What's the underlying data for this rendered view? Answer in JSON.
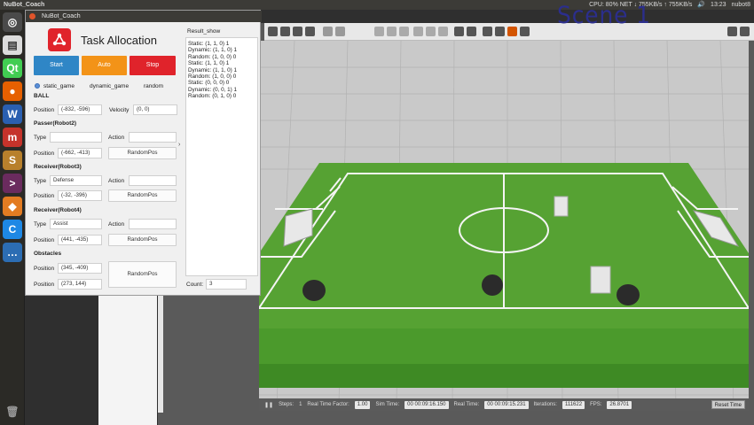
{
  "topbar": {
    "app_name": "NuBot_Coach",
    "tray_net": "CPU: 80% NET ↓ 755KB/s ↑ 755KB/s",
    "tray_time": "13:23",
    "tray_user": "nubot8"
  },
  "overlay_label": "Scene 1",
  "window": {
    "title": "NuBot_Coach",
    "app_title": "Task Allocation",
    "buttons": {
      "start": "Start",
      "auto": "Auto",
      "stop": "Stop"
    },
    "modes": [
      "static_game",
      "dynamic_game",
      "random"
    ],
    "selected_mode": "static_game",
    "ball": {
      "heading": "BALL",
      "position_label": "Position",
      "position_value": "(-832, -596)",
      "velocity_label": "Velocity",
      "velocity_value": "(0, 0)"
    },
    "passer": {
      "heading": "Passer(Robot2)",
      "type_label": "Type",
      "type_value": "",
      "action_label": "Action",
      "action_value": "",
      "position_label": "Position",
      "position_value": "(-662, -413)",
      "random_button": "RandomPos"
    },
    "receiver3": {
      "heading": "Receiver(Robot3)",
      "type_label": "Type",
      "type_value": "Defense",
      "action_label": "Action",
      "action_value": "",
      "position_label": "Position",
      "position_value": "(-32, -396)",
      "random_button": "RandomPos"
    },
    "receiver4": {
      "heading": "Receiver(Robot4)",
      "type_label": "Type",
      "type_value": "Assist",
      "action_label": "Action",
      "action_value": "",
      "position_label": "Position",
      "position_value": "(441, -435)",
      "random_button": "RandomPos"
    },
    "obstacles": {
      "heading": "Obstacles",
      "position_label": "Position",
      "positions": [
        "(345, -409)",
        "(273, 144)"
      ],
      "random_button": "RandomPos"
    },
    "result_title": "Result_show",
    "results": [
      "Static:  (1, 1, 0)  1",
      "Dynamic: (1, 1, 0)  1",
      "Random:  (1, 0, 0)  0",
      "Static:  (1, 1, 0)  1",
      "Dynamic: (1, 1, 0)  1",
      "Random:  (1, 0, 0)  0",
      "Static:  (0, 0, 0)  0",
      "Dynamic: (0, 0, 1)  1",
      "Random:  (0, 1, 0)  0"
    ],
    "count_label": "Count:",
    "count_value": "3"
  },
  "gazebo_bottom": {
    "steps_label": "Steps:",
    "steps_value": "1",
    "rtf_label": "Real Time Factor:",
    "rtf_value": "1.00",
    "sim_label": "Sim Time:",
    "sim_value": "00 00:09:16.150",
    "real_label": "Real Time:",
    "real_value": "00 00:09:15.231",
    "iter_label": "Iterations:",
    "iter_value": "111622",
    "fps_label": "FPS:",
    "fps_value": "26.8701",
    "reset_label": "Reset Time"
  },
  "colors": {
    "start": "#2f86c6",
    "auto": "#f39318",
    "stop": "#e0232b",
    "field_light": "#5fa83a",
    "field_dark": "#52992f",
    "logo": "#e0232b"
  }
}
